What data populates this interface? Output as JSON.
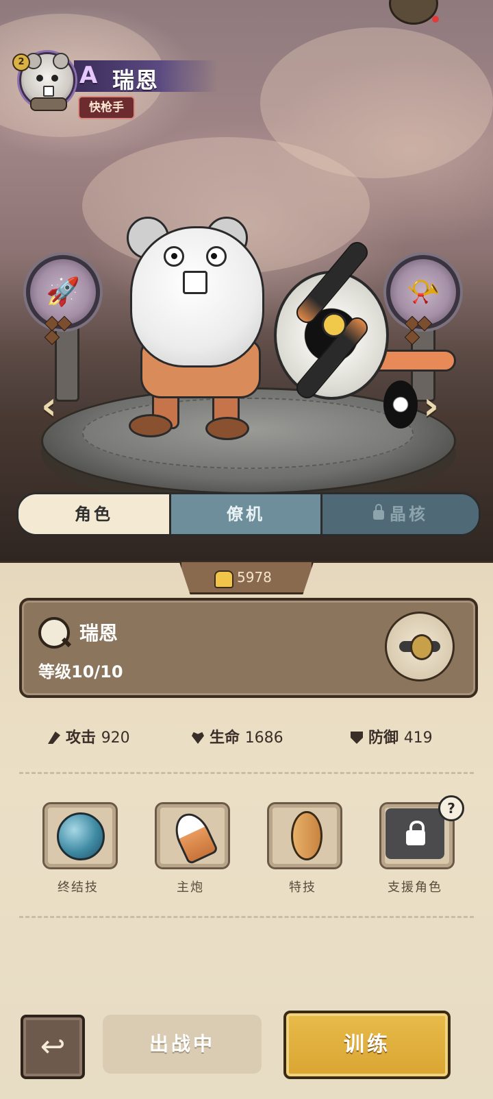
{
  "hero": {
    "rank": "A",
    "name": "瑞恩",
    "class": "快枪手",
    "avatar_level": "2"
  },
  "tabs": [
    {
      "label": "角色",
      "active": true,
      "locked": false
    },
    {
      "label": "僚机",
      "active": false,
      "locked": false
    },
    {
      "label": "晶核",
      "active": false,
      "locked": true
    }
  ],
  "currency": {
    "icon": "fist-icon",
    "value": "5978"
  },
  "card": {
    "name": "瑞恩",
    "level_text": "等级10/10"
  },
  "stats": [
    {
      "label": "攻击",
      "value": "920",
      "icon": "attack-icon"
    },
    {
      "label": "生命",
      "value": "1686",
      "icon": "heart-icon"
    },
    {
      "label": "防御",
      "value": "419",
      "icon": "shield-icon"
    }
  ],
  "skills": [
    {
      "label": "终结技",
      "icon": "orb-icon"
    },
    {
      "label": "主炮",
      "icon": "shell-icon"
    },
    {
      "label": "特技",
      "icon": "seed-icon"
    },
    {
      "label": "支援角色",
      "icon": "lock-icon",
      "locked": true
    }
  ],
  "help_label": "?",
  "buttons": {
    "deploy": "出战中",
    "train": "训练"
  },
  "colors": {
    "accent_gold": "#d9a532",
    "tab_active": "#f4ead3",
    "tab_wingman": "#6f8e9b",
    "tab_locked": "#4f6a76"
  }
}
